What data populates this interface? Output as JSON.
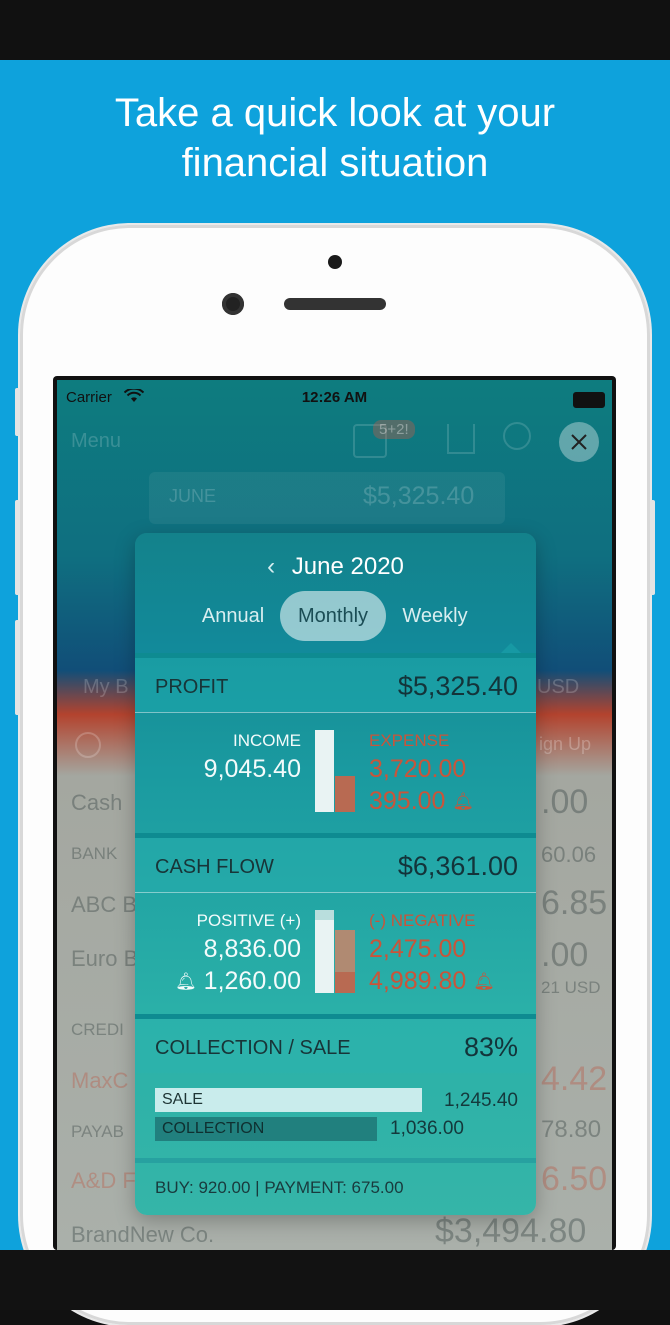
{
  "headline": {
    "line1": "Take a quick look at your",
    "line2": "financial situation"
  },
  "status_bar": {
    "carrier": "Carrier",
    "time": "12:26 AM"
  },
  "background_app": {
    "menu": "Menu",
    "badge": "5+2!",
    "month_label": "JUNE",
    "month_value": "$5,325.40",
    "my_label": "My B",
    "usd": "USD",
    "sign_up": "ign Up",
    "rows": [
      {
        "label": "Cash",
        "value": ".00"
      },
      {
        "label": "BANK",
        "value": "60.06"
      },
      {
        "label": "ABC B",
        "value": "6.85"
      },
      {
        "label": "Euro B",
        "value": ".00"
      },
      {
        "label": "CREDI",
        "value": "21 USD"
      },
      {
        "label": "MaxC",
        "value": "4.42"
      },
      {
        "label": "PAYAB",
        "value": "78.80"
      },
      {
        "label": "A&D F",
        "value": "6.50"
      },
      {
        "label": "BrandNew Co.",
        "value": "$3,494.80"
      }
    ]
  },
  "popup": {
    "month": "June 2020",
    "tabs": [
      "Annual",
      "Monthly",
      "Weekly"
    ],
    "active_tab": "Monthly",
    "profit": {
      "title": "PROFIT",
      "value": "$5,325.40",
      "income_label": "INCOME",
      "income_value": "9,045.40",
      "expense_label": "EXPENSE",
      "expense_value": "3,720.00",
      "expense_pending": "395.00"
    },
    "cash_flow": {
      "title": "CASH FLOW",
      "value": "$6,361.00",
      "positive_label": "POSITIVE (+)",
      "positive_value": "8,836.00",
      "positive_pending": "1,260.00",
      "negative_label": "(-) NEGATIVE",
      "negative_value": "2,475.00",
      "negative_pending": "4,989.80"
    },
    "collection": {
      "title": "COLLECTION / SALE",
      "value": "83%",
      "sale_label": "SALE",
      "sale_value": "1,245.40",
      "collection_label": "COLLECTION",
      "collection_value": "1,036.00"
    },
    "footer": "BUY: 920.00 | PAYMENT: 675.00"
  },
  "icons": {
    "close": "close-icon",
    "bell": "bell-icon",
    "chevron": "chevron-left-icon",
    "wifi": "wifi-icon",
    "battery": "battery-icon"
  },
  "colors": {
    "background": "#0ea2dc",
    "expense": "#c9553a",
    "popup": "#1a9aa0"
  }
}
